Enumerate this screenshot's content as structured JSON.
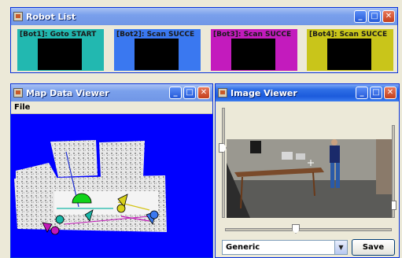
{
  "robot_list": {
    "title": "Robot List",
    "robots": [
      {
        "label": "[Bot1]: Goto START",
        "color": "#22b8b0"
      },
      {
        "label": "[Bot2]: Scan SUCCE",
        "color": "#3a78f0"
      },
      {
        "label": "[Bot3]: Scan SUCCE",
        "color": "#c31bbd"
      },
      {
        "label": "[Bot4]: Scan SUCCE",
        "color": "#c9c51a"
      }
    ]
  },
  "map_viewer": {
    "title": "Map Data Viewer",
    "menu_file": "File",
    "background": "#0000ff"
  },
  "image_viewer": {
    "title": "Image Viewer",
    "selected_option": "Generic",
    "save_label": "Save"
  },
  "window_buttons": {
    "minimize": "_",
    "maximize": "□",
    "close": "✕"
  }
}
